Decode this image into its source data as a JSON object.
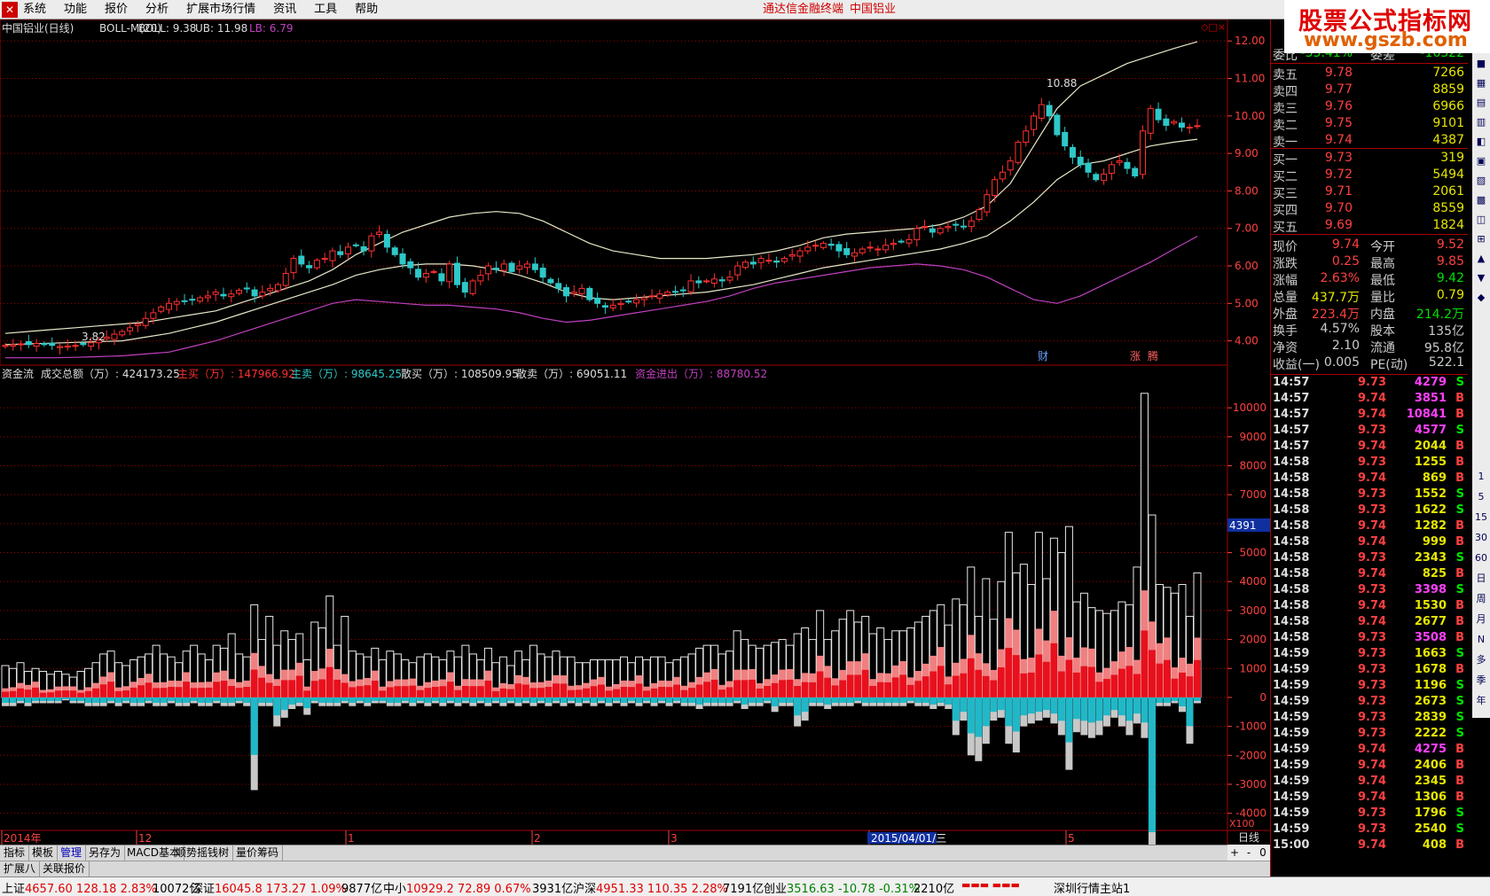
{
  "app": {
    "title": "通达信金融终端",
    "stock_title": "中国铝业",
    "site_line1": "股票公式指标网",
    "site_line2": "www.gszb.com"
  },
  "menu": [
    "系统",
    "功能",
    "报价",
    "分析",
    "扩展市场行情",
    "资讯",
    "工具",
    "帮助"
  ],
  "colors": {
    "up": "#ff3030",
    "down": "#2ec8c8",
    "boll": "#e8e8c8",
    "lb": "#c040c0",
    "grid": "#a00000",
    "axis": "#ff4040",
    "big_buy": "#e8101c",
    "small_buy": "#f08080",
    "big_sell": "#20b8c8",
    "small_sell": "#c8c8c8"
  },
  "price_chart": {
    "legend": {
      "title": "中国铝业(日线)",
      "indicator": "BOLL-M(20)",
      "boll": "BOLL: 9.38",
      "ub": "UB: 11.98",
      "lb": "LB: 6.79"
    },
    "high_label": "10.88",
    "low_label": "3.82",
    "markers": {
      "cai": "财",
      "zhang": "涨",
      "dui": "腾"
    }
  },
  "chart_data": [
    {
      "type": "candlestick",
      "title": "中国铝业(日线) BOLL-M(20)",
      "yaxis_ticks": [
        "12.00",
        "11.00",
        "10.00",
        "9.00",
        "8.00",
        "7.00",
        "6.00",
        "5.00",
        "4.00"
      ],
      "ylim": [
        3.4,
        12.1
      ],
      "ohlc_close": [
        3.88,
        3.9,
        3.92,
        3.9,
        3.93,
        3.9,
        3.88,
        3.85,
        3.86,
        3.88,
        3.9,
        3.95,
        4.02,
        4.1,
        4.18,
        4.25,
        4.35,
        4.45,
        4.6,
        4.75,
        4.9,
        5.0,
        5.05,
        5.05,
        5.1,
        5.15,
        5.2,
        5.3,
        5.2,
        5.25,
        5.35,
        5.4,
        5.2,
        5.3,
        5.4,
        5.5,
        5.8,
        6.2,
        6.05,
        5.95,
        6.15,
        6.2,
        6.4,
        6.3,
        6.5,
        6.55,
        6.4,
        6.8,
        6.9,
        6.5,
        6.3,
        6.05,
        5.95,
        5.7,
        5.8,
        5.85,
        5.6,
        6.05,
        5.5,
        5.3,
        5.6,
        5.75,
        6.0,
        5.9,
        6.05,
        5.85,
        6.0,
        6.05,
        5.9,
        5.7,
        5.55,
        5.4,
        5.2,
        5.3,
        5.4,
        5.1,
        5.0,
        4.9,
        4.95,
        5.0,
        5.05,
        5.1,
        5.15,
        5.2,
        5.25,
        5.3,
        5.3,
        5.35,
        5.6,
        5.55,
        5.6,
        5.65,
        5.6,
        5.7,
        6.0,
        6.1,
        6.05,
        6.2,
        6.15,
        6.1,
        6.2,
        6.3,
        6.4,
        6.5,
        6.55,
        6.6,
        6.55,
        6.4,
        6.3,
        6.35,
        6.45,
        6.5,
        6.45,
        6.55,
        6.6,
        6.65,
        6.7,
        7.0,
        7.05,
        6.9,
        7.0,
        7.05,
        7.1,
        7.05,
        7.2,
        7.5,
        7.9,
        8.3,
        8.5,
        8.8,
        9.3,
        9.6,
        10.0,
        10.3,
        10.0,
        9.5,
        9.2,
        8.9,
        8.7,
        8.5,
        8.3,
        8.45,
        8.7,
        8.8,
        8.6,
        8.4,
        9.6,
        10.2,
        9.9,
        9.75,
        9.85,
        9.7,
        9.7,
        9.74
      ],
      "ub": [
        4.2,
        4.25,
        4.3,
        4.35,
        4.4,
        4.45,
        4.5,
        4.6,
        4.7,
        4.8,
        5.0,
        5.2,
        5.4,
        5.6,
        5.9,
        6.3,
        6.6,
        6.9,
        7.1,
        7.3,
        7.4,
        7.45,
        7.4,
        7.2,
        6.9,
        6.6,
        6.4,
        6.3,
        6.2,
        6.2,
        6.2,
        6.25,
        6.3,
        6.4,
        6.55,
        6.75,
        6.85,
        6.9,
        6.95,
        7.0,
        7.1,
        7.3,
        7.6,
        8.2,
        9.2,
        10.2,
        10.8,
        11.1,
        11.4,
        11.6,
        11.8,
        11.98
      ],
      "boll": [
        3.9,
        3.92,
        3.94,
        3.96,
        3.98,
        4.0,
        4.1,
        4.2,
        4.35,
        4.5,
        4.7,
        4.9,
        5.1,
        5.3,
        5.5,
        5.75,
        5.9,
        6.0,
        6.05,
        6.05,
        6.0,
        5.9,
        5.75,
        5.55,
        5.3,
        5.15,
        5.1,
        5.15,
        5.2,
        5.25,
        5.3,
        5.4,
        5.5,
        5.65,
        5.8,
        5.95,
        6.05,
        6.15,
        6.25,
        6.35,
        6.45,
        6.6,
        6.8,
        7.2,
        7.7,
        8.3,
        8.7,
        8.8,
        9.0,
        9.2,
        9.3,
        9.38
      ],
      "lb": [
        3.55,
        3.55,
        3.55,
        3.56,
        3.58,
        3.6,
        3.65,
        3.7,
        3.85,
        4.0,
        4.2,
        4.4,
        4.6,
        4.8,
        5.0,
        5.1,
        5.05,
        5.0,
        4.95,
        4.95,
        4.9,
        4.85,
        4.75,
        4.6,
        4.5,
        4.55,
        4.65,
        4.75,
        4.85,
        4.95,
        5.05,
        5.2,
        5.4,
        5.55,
        5.65,
        5.75,
        5.85,
        5.95,
        6.0,
        6.05,
        6.0,
        5.9,
        5.7,
        5.4,
        5.1,
        5.0,
        5.2,
        5.5,
        5.8,
        6.1,
        6.45,
        6.79
      ]
    },
    {
      "type": "bar",
      "title": "资金流",
      "legend": [
        "成交总额（万）: 424173.25",
        "主买（万）: 147966.92",
        "主卖（万）: 98645.25",
        "散买（万）: 108509.95",
        "散卖（万）: 69051.11",
        "资金进出（万）: 88780.52"
      ],
      "yaxis_ticks": [
        "10000",
        "9000",
        "8000",
        "7000",
        "6000",
        "5000",
        "4000",
        "3000",
        "2000",
        "1000",
        "0",
        "-1000",
        "-2000",
        "-3000",
        "-4000"
      ],
      "ylim": [
        -4500,
        10800
      ],
      "cursor_value": "4391",
      "unit": "X100",
      "buy_total": [
        1100,
        1000,
        1200,
        900,
        1000,
        900,
        800,
        900,
        800,
        700,
        900,
        1000,
        1200,
        1500,
        1600,
        1200,
        1100,
        1300,
        1400,
        1500,
        1800,
        1500,
        1400,
        1200,
        1600,
        1800,
        1500,
        1300,
        1800,
        1700,
        2200,
        1500,
        1400,
        3200,
        2000,
        2800,
        1800,
        2300,
        2000,
        2200,
        1300,
        2600,
        2400,
        3500,
        1800,
        2800,
        1600,
        1500,
        1400,
        1700,
        1300,
        1600,
        1500,
        1300,
        1200,
        1400,
        1500,
        1400,
        1300,
        1600,
        1400,
        1800,
        1500,
        1300,
        1700,
        1200,
        1400,
        1100,
        1600,
        1300,
        1800,
        1500,
        1400,
        1600,
        1400,
        1400,
        1200,
        1200,
        1300,
        1300,
        1300,
        1300,
        1400,
        1200,
        1400,
        1300,
        1400,
        1400,
        1200,
        1300,
        1400,
        1500,
        1700,
        1800,
        1800,
        1500,
        1600,
        2300,
        2000,
        1800,
        1700,
        1800,
        1900,
        2000,
        1800,
        2200,
        2400,
        2000,
        3000,
        2000,
        2300,
        2700,
        3000,
        2600,
        2800,
        2200,
        2400,
        2000,
        2300,
        2300,
        2400,
        2600,
        2800,
        3000,
        3200,
        2500,
        3400,
        3200,
        4500,
        2800,
        4100,
        2700,
        4000,
        5700,
        4300,
        4600,
        3900,
        5700,
        4100,
        5500,
        5000,
        5900,
        3300,
        3600,
        3100,
        3000,
        2900,
        3000,
        3300,
        3200,
        4500,
        10500,
        6300,
        3900,
        3800,
        3600,
        3900,
        2800,
        4300
      ],
      "sell_total": [
        -300,
        -300,
        -200,
        -300,
        -200,
        -200,
        -200,
        -200,
        -100,
        -200,
        -200,
        -300,
        -300,
        -300,
        -200,
        -300,
        -200,
        -300,
        -300,
        -200,
        -300,
        -300,
        -200,
        -300,
        -300,
        -200,
        -300,
        -300,
        -200,
        -300,
        -300,
        -200,
        -300,
        -3200,
        -300,
        -300,
        -1000,
        -700,
        -400,
        -300,
        -600,
        -200,
        -300,
        -300,
        -300,
        -200,
        -300,
        -200,
        -300,
        -200,
        -200,
        -300,
        -300,
        -200,
        -300,
        -200,
        -300,
        -200,
        -300,
        -200,
        -300,
        -200,
        -300,
        -200,
        -300,
        -200,
        -300,
        -200,
        -300,
        -200,
        -300,
        -200,
        -300,
        -200,
        -300,
        -200,
        -300,
        -200,
        -300,
        -200,
        -300,
        -200,
        -300,
        -200,
        -300,
        -200,
        -300,
        -200,
        -300,
        -200,
        -300,
        -300,
        -400,
        -300,
        -300,
        -300,
        -300,
        -200,
        -400,
        -300,
        -300,
        -200,
        -500,
        -300,
        -300,
        -1000,
        -800,
        -300,
        -300,
        -400,
        -300,
        -300,
        -300,
        -200,
        -300,
        -300,
        -300,
        -300,
        -300,
        -300,
        -200,
        -300,
        -300,
        -400,
        -300,
        -400,
        -1300,
        -800,
        -2000,
        -2200,
        -1600,
        -800,
        -700,
        -1600,
        -1900,
        -1000,
        -900,
        -800,
        -700,
        -900,
        -1300,
        -2500,
        -1200,
        -1300,
        -1400,
        -1300,
        -1000,
        -700,
        -1000,
        -1300,
        -900,
        -1400,
        -7500,
        -300,
        -300,
        -200,
        -500,
        -1600,
        -200
      ]
    }
  ],
  "xaxis": {
    "labels": [
      "2014年",
      "12",
      "1",
      "2",
      "3",
      "2015/04/01/三",
      "5"
    ],
    "period": "日线"
  },
  "orderbook": {
    "weibi": {
      "label": "委比",
      "value": "-33.41%",
      "label2": "委差",
      "value2": "-16322"
    },
    "asks": [
      {
        "n": "卖五",
        "p": "9.78",
        "v": "7266"
      },
      {
        "n": "卖四",
        "p": "9.77",
        "v": "8859"
      },
      {
        "n": "卖三",
        "p": "9.76",
        "v": "6966"
      },
      {
        "n": "卖二",
        "p": "9.75",
        "v": "9101"
      },
      {
        "n": "卖一",
        "p": "9.74",
        "v": "4387"
      }
    ],
    "bids": [
      {
        "n": "买一",
        "p": "9.73",
        "v": "319"
      },
      {
        "n": "买二",
        "p": "9.72",
        "v": "5494"
      },
      {
        "n": "买三",
        "p": "9.71",
        "v": "2061"
      },
      {
        "n": "买四",
        "p": "9.70",
        "v": "8559"
      },
      {
        "n": "买五",
        "p": "9.69",
        "v": "1824"
      }
    ]
  },
  "stats": [
    {
      "l1": "现价",
      "v1": "9.74",
      "l2": "今开",
      "v2": "9.52"
    },
    {
      "l1": "涨跌",
      "v1": "0.25",
      "l2": "最高",
      "v2": "9.85"
    },
    {
      "l1": "涨幅",
      "v1": "2.63%",
      "l2": "最低",
      "v2": "9.42"
    },
    {
      "l1": "总量",
      "v1": "437.7万",
      "l2": "量比",
      "v2": "0.79"
    },
    {
      "l1": "外盘",
      "v1": "223.4万",
      "l2": "内盘",
      "v2": "214.2万"
    },
    {
      "l1": "换手",
      "v1": "4.57%",
      "l2": "股本",
      "v2": "135亿"
    },
    {
      "l1": "净资",
      "v1": "2.10",
      "l2": "流通",
      "v2": "95.8亿"
    },
    {
      "l1": "收益(一)",
      "v1": "0.005",
      "l2": "PE(动)",
      "v2": "522.1"
    }
  ],
  "ticks": [
    {
      "t": "14:57",
      "p": "9.73",
      "v": "4279",
      "bs": "S"
    },
    {
      "t": "14:57",
      "p": "9.74",
      "v": "3851",
      "bs": "B"
    },
    {
      "t": "14:57",
      "p": "9.74",
      "v": "10841",
      "bs": "B"
    },
    {
      "t": "14:57",
      "p": "9.73",
      "v": "4577",
      "bs": "S"
    },
    {
      "t": "14:57",
      "p": "9.74",
      "v": "2044",
      "bs": "B"
    },
    {
      "t": "14:58",
      "p": "9.73",
      "v": "1255",
      "bs": "B"
    },
    {
      "t": "14:58",
      "p": "9.74",
      "v": "869",
      "bs": "B"
    },
    {
      "t": "14:58",
      "p": "9.73",
      "v": "1552",
      "bs": "S"
    },
    {
      "t": "14:58",
      "p": "9.73",
      "v": "1622",
      "bs": "S"
    },
    {
      "t": "14:58",
      "p": "9.74",
      "v": "1282",
      "bs": "B"
    },
    {
      "t": "14:58",
      "p": "9.74",
      "v": "999",
      "bs": "B"
    },
    {
      "t": "14:58",
      "p": "9.73",
      "v": "2343",
      "bs": "S"
    },
    {
      "t": "14:58",
      "p": "9.74",
      "v": "825",
      "bs": "B"
    },
    {
      "t": "14:58",
      "p": "9.73",
      "v": "3398",
      "bs": "S"
    },
    {
      "t": "14:58",
      "p": "9.74",
      "v": "1530",
      "bs": "B"
    },
    {
      "t": "14:58",
      "p": "9.74",
      "v": "2677",
      "bs": "B"
    },
    {
      "t": "14:58",
      "p": "9.73",
      "v": "3508",
      "bs": "B"
    },
    {
      "t": "14:59",
      "p": "9.73",
      "v": "1663",
      "bs": "S"
    },
    {
      "t": "14:59",
      "p": "9.73",
      "v": "1678",
      "bs": "B"
    },
    {
      "t": "14:59",
      "p": "9.73",
      "v": "1196",
      "bs": "S"
    },
    {
      "t": "14:59",
      "p": "9.73",
      "v": "2673",
      "bs": "S"
    },
    {
      "t": "14:59",
      "p": "9.73",
      "v": "2839",
      "bs": "S"
    },
    {
      "t": "14:59",
      "p": "9.73",
      "v": "2222",
      "bs": "S"
    },
    {
      "t": "14:59",
      "p": "9.74",
      "v": "4275",
      "bs": "B"
    },
    {
      "t": "14:59",
      "p": "9.74",
      "v": "2406",
      "bs": "B"
    },
    {
      "t": "14:59",
      "p": "9.74",
      "v": "2345",
      "bs": "B"
    },
    {
      "t": "14:59",
      "p": "9.74",
      "v": "1306",
      "bs": "B"
    },
    {
      "t": "14:59",
      "p": "9.73",
      "v": "1796",
      "bs": "S"
    },
    {
      "t": "14:59",
      "p": "9.73",
      "v": "2540",
      "bs": "S"
    },
    {
      "t": "15:00",
      "p": "9.74",
      "v": "408",
      "bs": "B"
    }
  ],
  "quote_tabs": [
    "笔",
    "价",
    "细",
    "日",
    "势",
    "联",
    "值",
    "筹"
  ],
  "right_toolbar": [
    "1",
    "5",
    "15",
    "30",
    "60",
    "日",
    "周",
    "月",
    "N",
    "多",
    "季",
    "年"
  ],
  "bottom_tabs1": [
    "指标",
    "模板",
    "管理",
    "另存为",
    "MACD基本",
    "顺势摇钱树",
    "量价筹码"
  ],
  "bottom_tabs2": [
    "扩展八",
    "关联报价"
  ],
  "zoom": [
    "+",
    "-",
    "0"
  ],
  "status": {
    "sh": {
      "name": "上证",
      "v": "4657.60",
      "c": "128.18",
      "p": "2.83%",
      "amt": "10072亿"
    },
    "sz": {
      "name": "深证",
      "v": "16045.8",
      "c": "173.27",
      "p": "1.09%",
      "amt": "9877亿"
    },
    "zx": {
      "name": "中小",
      "v": "10929.2",
      "c": "72.89",
      "p": "0.67%",
      "amt": "3931亿"
    },
    "hs": {
      "name": "沪深",
      "v": "4951.33",
      "c": "110.35",
      "p": "2.28%",
      "amt": "7191亿"
    },
    "cy": {
      "name": "创业",
      "v": "3516.63",
      "c": "-10.78",
      "p": "-0.31%",
      "amt": "2210亿"
    },
    "server": "深圳行情主站1"
  }
}
